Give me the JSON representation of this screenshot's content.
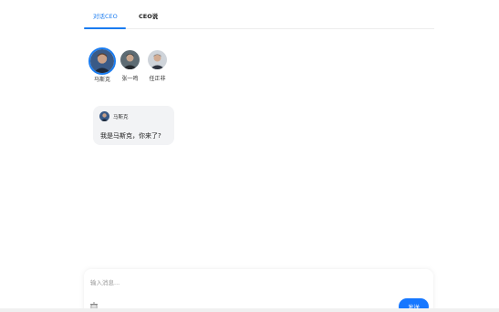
{
  "tabs": [
    {
      "label": "对话CEO",
      "active": true
    },
    {
      "label": "CEO说",
      "active": false
    }
  ],
  "ceos": [
    {
      "name": "马斯克",
      "selected": true
    },
    {
      "name": "张一鸣",
      "selected": false
    },
    {
      "name": "任正非",
      "selected": false
    }
  ],
  "message": {
    "sender": "马斯克",
    "text": "我是马斯克，你来了?"
  },
  "composer": {
    "placeholder": "输入消息...",
    "send_label": "发送"
  },
  "colors": {
    "accent": "#1a7cf0",
    "send_button": "#1677ff",
    "bubble_bg": "#f2f3f5"
  },
  "icons": {
    "clear": "trash-icon"
  }
}
